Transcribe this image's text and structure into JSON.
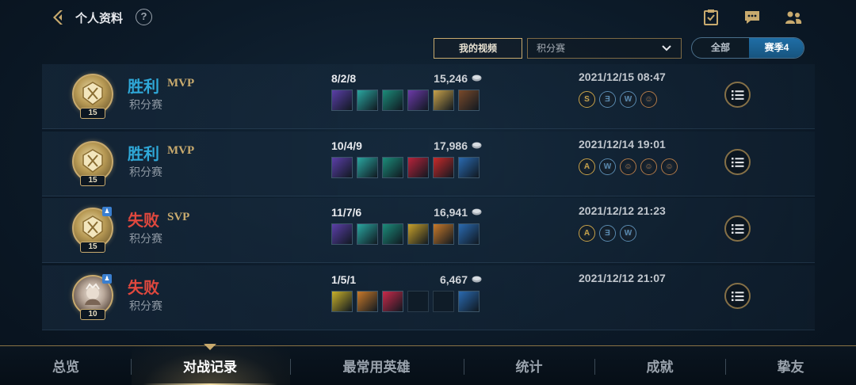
{
  "header": {
    "title": "个人资料",
    "help_label": "?",
    "icons": [
      "back-icon",
      "help-icon",
      "clipboard-check-icon",
      "chat-icon",
      "friends-icon"
    ]
  },
  "filters": {
    "video_label": "我的视频",
    "mode_value": "积分赛",
    "season_all": "全部",
    "season_current": "赛季4"
  },
  "matches": [
    {
      "result": "胜利",
      "result_type": "win",
      "badge": "MVP",
      "queue": "积分赛",
      "level": "15",
      "avatar": "rank-emblem",
      "team": false,
      "kda": "8/2/8",
      "gold": "15,246",
      "items": [
        "#5b3fa8",
        "#2aa6a0",
        "#1c8c7a",
        "#6c3aa8",
        "#c8a24a",
        "#7a4a2a"
      ],
      "datetime": "2021/12/15 08:47",
      "honors": [
        [
          "S",
          "#c8a24a"
        ],
        [
          "Ǝ",
          "#5a8ab0"
        ],
        [
          "W",
          "#5a8ab0"
        ],
        [
          "☺",
          "#b07a4a"
        ]
      ]
    },
    {
      "result": "胜利",
      "result_type": "win",
      "badge": "MVP",
      "queue": "积分赛",
      "level": "15",
      "avatar": "rank-emblem",
      "team": false,
      "kda": "10/4/9",
      "gold": "17,986",
      "items": [
        "#5b3fa8",
        "#2aa6a0",
        "#1c8c7a",
        "#b8233a",
        "#c82a2a",
        "#2a6ab0"
      ],
      "datetime": "2021/12/14 19:01",
      "honors": [
        [
          "A",
          "#c8a24a"
        ],
        [
          "W",
          "#5a8ab0"
        ],
        [
          "☺",
          "#b07a4a"
        ],
        [
          "☺",
          "#b07a4a"
        ],
        [
          "☺",
          "#b07a4a"
        ]
      ]
    },
    {
      "result": "失败",
      "result_type": "lose",
      "badge": "SVP",
      "queue": "积分赛",
      "level": "15",
      "avatar": "rank-emblem",
      "team": true,
      "kda": "11/7/6",
      "gold": "16,941",
      "items": [
        "#5b3fa8",
        "#2aa6a0",
        "#1c8c7a",
        "#c8a02a",
        "#c87a2a",
        "#2a6ab0"
      ],
      "datetime": "2021/12/12 21:23",
      "honors": [
        [
          "A",
          "#c8a24a"
        ],
        [
          "Ǝ",
          "#5a8ab0"
        ],
        [
          "W",
          "#5a8ab0"
        ]
      ]
    },
    {
      "result": "失败",
      "result_type": "lose",
      "badge": "",
      "queue": "积分赛",
      "level": "10",
      "avatar": "champion",
      "team": true,
      "kda": "1/5/1",
      "gold": "6,467",
      "items": [
        "#c8b02a",
        "#c87a2a",
        "#c82a4a",
        "",
        "",
        "#2a6ab0"
      ],
      "datetime": "2021/12/12 21:07",
      "honors": []
    }
  ],
  "team_icon_glyph": "♟",
  "bottom_nav": [
    "总览",
    "对战记录",
    "最常用英雄",
    "统计",
    "成就",
    "挚友"
  ],
  "colors": {
    "accent_gold": "#c8aa6e",
    "win": "#2fa8d8",
    "lose": "#e0483e"
  }
}
